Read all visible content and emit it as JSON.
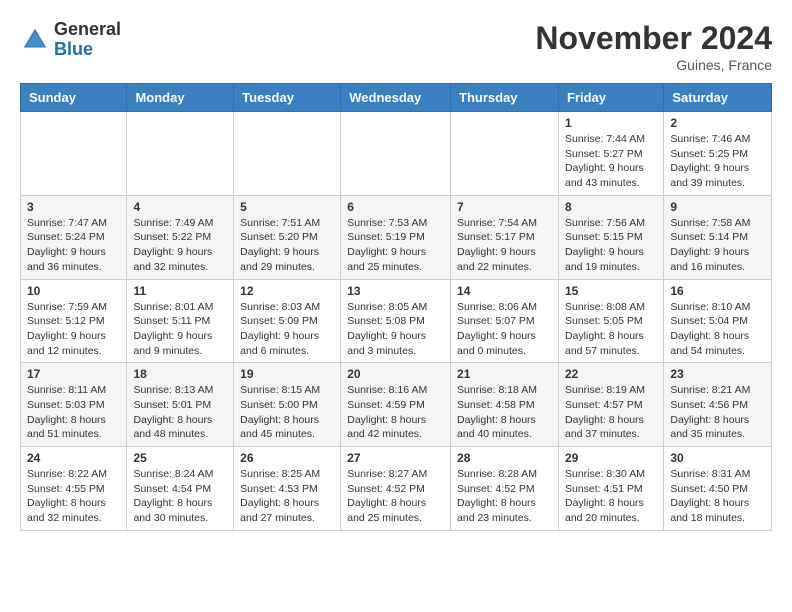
{
  "header": {
    "logo_general": "General",
    "logo_blue": "Blue",
    "month_title": "November 2024",
    "location": "Guines, France"
  },
  "days_of_week": [
    "Sunday",
    "Monday",
    "Tuesday",
    "Wednesday",
    "Thursday",
    "Friday",
    "Saturday"
  ],
  "weeks": [
    [
      {
        "day": "",
        "info": ""
      },
      {
        "day": "",
        "info": ""
      },
      {
        "day": "",
        "info": ""
      },
      {
        "day": "",
        "info": ""
      },
      {
        "day": "",
        "info": ""
      },
      {
        "day": "1",
        "info": "Sunrise: 7:44 AM\nSunset: 5:27 PM\nDaylight: 9 hours and 43 minutes."
      },
      {
        "day": "2",
        "info": "Sunrise: 7:46 AM\nSunset: 5:25 PM\nDaylight: 9 hours and 39 minutes."
      }
    ],
    [
      {
        "day": "3",
        "info": "Sunrise: 7:47 AM\nSunset: 5:24 PM\nDaylight: 9 hours and 36 minutes."
      },
      {
        "day": "4",
        "info": "Sunrise: 7:49 AM\nSunset: 5:22 PM\nDaylight: 9 hours and 32 minutes."
      },
      {
        "day": "5",
        "info": "Sunrise: 7:51 AM\nSunset: 5:20 PM\nDaylight: 9 hours and 29 minutes."
      },
      {
        "day": "6",
        "info": "Sunrise: 7:53 AM\nSunset: 5:19 PM\nDaylight: 9 hours and 25 minutes."
      },
      {
        "day": "7",
        "info": "Sunrise: 7:54 AM\nSunset: 5:17 PM\nDaylight: 9 hours and 22 minutes."
      },
      {
        "day": "8",
        "info": "Sunrise: 7:56 AM\nSunset: 5:15 PM\nDaylight: 9 hours and 19 minutes."
      },
      {
        "day": "9",
        "info": "Sunrise: 7:58 AM\nSunset: 5:14 PM\nDaylight: 9 hours and 16 minutes."
      }
    ],
    [
      {
        "day": "10",
        "info": "Sunrise: 7:59 AM\nSunset: 5:12 PM\nDaylight: 9 hours and 12 minutes."
      },
      {
        "day": "11",
        "info": "Sunrise: 8:01 AM\nSunset: 5:11 PM\nDaylight: 9 hours and 9 minutes."
      },
      {
        "day": "12",
        "info": "Sunrise: 8:03 AM\nSunset: 5:09 PM\nDaylight: 9 hours and 6 minutes."
      },
      {
        "day": "13",
        "info": "Sunrise: 8:05 AM\nSunset: 5:08 PM\nDaylight: 9 hours and 3 minutes."
      },
      {
        "day": "14",
        "info": "Sunrise: 8:06 AM\nSunset: 5:07 PM\nDaylight: 9 hours and 0 minutes."
      },
      {
        "day": "15",
        "info": "Sunrise: 8:08 AM\nSunset: 5:05 PM\nDaylight: 8 hours and 57 minutes."
      },
      {
        "day": "16",
        "info": "Sunrise: 8:10 AM\nSunset: 5:04 PM\nDaylight: 8 hours and 54 minutes."
      }
    ],
    [
      {
        "day": "17",
        "info": "Sunrise: 8:11 AM\nSunset: 5:03 PM\nDaylight: 8 hours and 51 minutes."
      },
      {
        "day": "18",
        "info": "Sunrise: 8:13 AM\nSunset: 5:01 PM\nDaylight: 8 hours and 48 minutes."
      },
      {
        "day": "19",
        "info": "Sunrise: 8:15 AM\nSunset: 5:00 PM\nDaylight: 8 hours and 45 minutes."
      },
      {
        "day": "20",
        "info": "Sunrise: 8:16 AM\nSunset: 4:59 PM\nDaylight: 8 hours and 42 minutes."
      },
      {
        "day": "21",
        "info": "Sunrise: 8:18 AM\nSunset: 4:58 PM\nDaylight: 8 hours and 40 minutes."
      },
      {
        "day": "22",
        "info": "Sunrise: 8:19 AM\nSunset: 4:57 PM\nDaylight: 8 hours and 37 minutes."
      },
      {
        "day": "23",
        "info": "Sunrise: 8:21 AM\nSunset: 4:56 PM\nDaylight: 8 hours and 35 minutes."
      }
    ],
    [
      {
        "day": "24",
        "info": "Sunrise: 8:22 AM\nSunset: 4:55 PM\nDaylight: 8 hours and 32 minutes."
      },
      {
        "day": "25",
        "info": "Sunrise: 8:24 AM\nSunset: 4:54 PM\nDaylight: 8 hours and 30 minutes."
      },
      {
        "day": "26",
        "info": "Sunrise: 8:25 AM\nSunset: 4:53 PM\nDaylight: 8 hours and 27 minutes."
      },
      {
        "day": "27",
        "info": "Sunrise: 8:27 AM\nSunset: 4:52 PM\nDaylight: 8 hours and 25 minutes."
      },
      {
        "day": "28",
        "info": "Sunrise: 8:28 AM\nSunset: 4:52 PM\nDaylight: 8 hours and 23 minutes."
      },
      {
        "day": "29",
        "info": "Sunrise: 8:30 AM\nSunset: 4:51 PM\nDaylight: 8 hours and 20 minutes."
      },
      {
        "day": "30",
        "info": "Sunrise: 8:31 AM\nSunset: 4:50 PM\nDaylight: 8 hours and 18 minutes."
      }
    ]
  ]
}
